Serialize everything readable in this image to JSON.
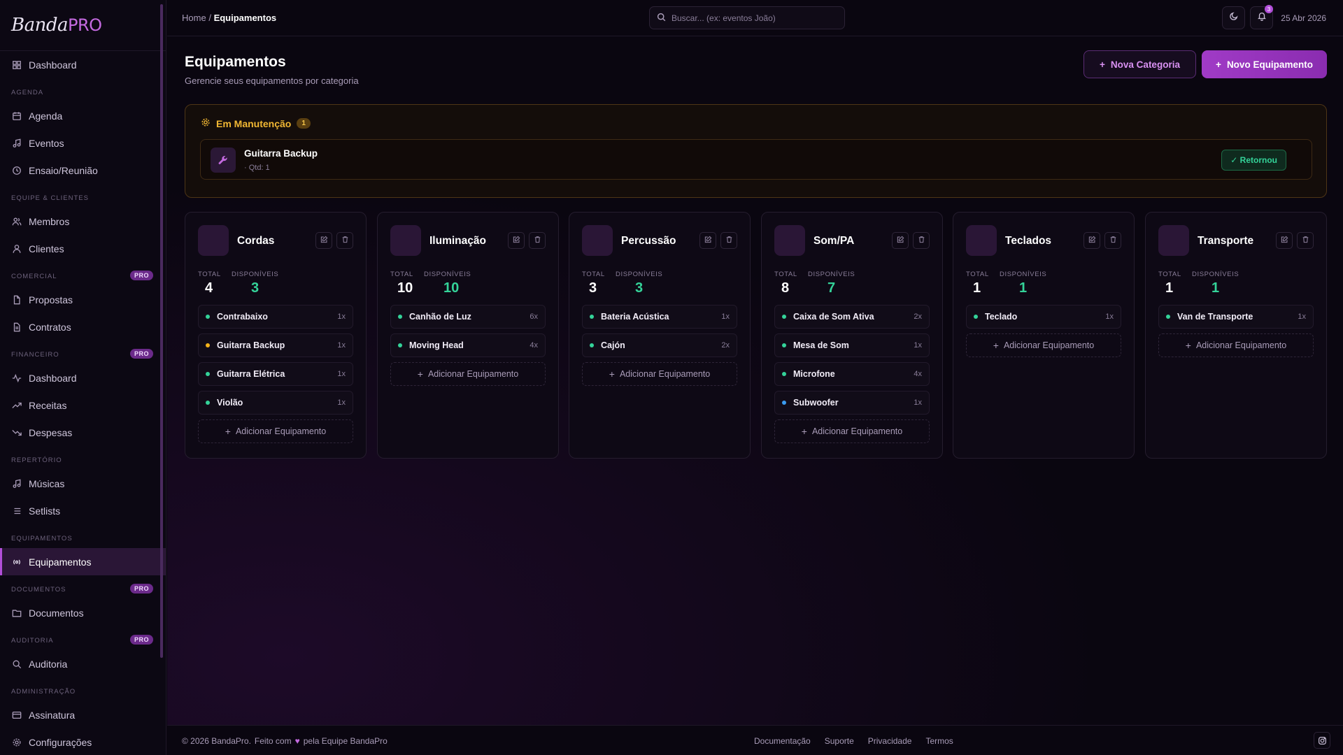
{
  "app": {
    "logo_main": "Banda",
    "logo_accent": "PRO"
  },
  "sidebar": {
    "items": [
      {
        "type": "item",
        "label": "Dashboard",
        "icon": "dashboard-icon"
      },
      {
        "type": "section",
        "label": "AGENDA"
      },
      {
        "type": "item",
        "label": "Agenda",
        "icon": "calendar-icon"
      },
      {
        "type": "item",
        "label": "Eventos",
        "icon": "music-note-icon"
      },
      {
        "type": "item",
        "label": "Ensaio/Reunião",
        "icon": "clock-icon"
      },
      {
        "type": "section",
        "label": "EQUIPE & CLIENTES"
      },
      {
        "type": "item",
        "label": "Membros",
        "icon": "users-icon"
      },
      {
        "type": "item",
        "label": "Clientes",
        "icon": "user-icon"
      },
      {
        "type": "section",
        "label": "COMERCIAL",
        "badge": "PRO"
      },
      {
        "type": "item",
        "label": "Propostas",
        "icon": "file-icon"
      },
      {
        "type": "item",
        "label": "Contratos",
        "icon": "contract-icon"
      },
      {
        "type": "section",
        "label": "FINANCEIRO",
        "badge": "PRO"
      },
      {
        "type": "item",
        "label": "Dashboard",
        "icon": "activity-icon"
      },
      {
        "type": "item",
        "label": "Receitas",
        "icon": "trend-up-icon"
      },
      {
        "type": "item",
        "label": "Despesas",
        "icon": "trend-down-icon"
      },
      {
        "type": "section",
        "label": "REPERTÓRIO"
      },
      {
        "type": "item",
        "label": "Músicas",
        "icon": "music-note-icon"
      },
      {
        "type": "item",
        "label": "Setlists",
        "icon": "list-icon"
      },
      {
        "type": "section",
        "label": "EQUIPAMENTOS"
      },
      {
        "type": "item",
        "label": "Equipamentos",
        "icon": "radio-icon",
        "active": true
      },
      {
        "type": "section",
        "label": "DOCUMENTOS",
        "badge": "PRO"
      },
      {
        "type": "item",
        "label": "Documentos",
        "icon": "folder-icon"
      },
      {
        "type": "section",
        "label": "AUDITORIA",
        "badge": "PRO"
      },
      {
        "type": "item",
        "label": "Auditoria",
        "icon": "search-icon"
      },
      {
        "type": "section",
        "label": "ADMINISTRAÇÃO"
      },
      {
        "type": "item",
        "label": "Assinatura",
        "icon": "card-icon"
      },
      {
        "type": "item",
        "label": "Configurações",
        "icon": "gear-icon"
      }
    ]
  },
  "topbar": {
    "breadcrumb_home": "Home",
    "breadcrumb_sep": "/",
    "breadcrumb_current": "Equipamentos",
    "search_placeholder": "Buscar... (ex: eventos João)",
    "notif_count": "3",
    "date": "25 Abr 2026"
  },
  "page": {
    "title": "Equipamentos",
    "subtitle": "Gerencie seus equipamentos por categoria",
    "btn_new_category": "Nova Categoria",
    "btn_new_equipment": "Novo Equipamento"
  },
  "maintenance": {
    "title": "Em Manutenção",
    "count": "1",
    "item_name": "Guitarra Backup",
    "item_qty": "· Qtd: 1",
    "returned_label": "✓ Retornou"
  },
  "labels": {
    "total": "TOTAL",
    "available": "DISPONÍVEIS",
    "add_equipment": "Adicionar Equipamento"
  },
  "colors": {
    "accent": "#b24fd9",
    "available": "#34d399",
    "warning": "#f5b31a",
    "info": "#3b9cf0"
  },
  "categories": [
    {
      "name": "Cordas",
      "total": "4",
      "available": "3",
      "items": [
        {
          "name": "Contrabaixo",
          "qty": "1x",
          "status": "ok"
        },
        {
          "name": "Guitarra Backup",
          "qty": "1x",
          "status": "warn"
        },
        {
          "name": "Guitarra Elétrica",
          "qty": "1x",
          "status": "ok"
        },
        {
          "name": "Violão",
          "qty": "1x",
          "status": "ok"
        }
      ]
    },
    {
      "name": "Iluminação",
      "total": "10",
      "available": "10",
      "items": [
        {
          "name": "Canhão de Luz",
          "qty": "6x",
          "status": "ok"
        },
        {
          "name": "Moving Head",
          "qty": "4x",
          "status": "ok"
        }
      ]
    },
    {
      "name": "Percussão",
      "total": "3",
      "available": "3",
      "items": [
        {
          "name": "Bateria Acústica",
          "qty": "1x",
          "status": "ok"
        },
        {
          "name": "Cajón",
          "qty": "2x",
          "status": "ok"
        }
      ]
    },
    {
      "name": "Som/PA",
      "total": "8",
      "available": "7",
      "items": [
        {
          "name": "Caixa de Som Ativa",
          "qty": "2x",
          "status": "ok"
        },
        {
          "name": "Mesa de Som",
          "qty": "1x",
          "status": "ok"
        },
        {
          "name": "Microfone",
          "qty": "4x",
          "status": "ok"
        },
        {
          "name": "Subwoofer",
          "qty": "1x",
          "status": "info"
        }
      ]
    },
    {
      "name": "Teclados",
      "total": "1",
      "available": "1",
      "items": [
        {
          "name": "Teclado",
          "qty": "1x",
          "status": "ok"
        }
      ]
    },
    {
      "name": "Transporte",
      "total": "1",
      "available": "1",
      "items": [
        {
          "name": "Van de Transporte",
          "qty": "1x",
          "status": "ok"
        }
      ]
    }
  ],
  "footer": {
    "copyright": "© 2026 BandaPro.",
    "made_with": "Feito com",
    "by_team": "pela Equipe BandaPro",
    "links": [
      "Documentação",
      "Suporte",
      "Privacidade",
      "Termos"
    ]
  }
}
